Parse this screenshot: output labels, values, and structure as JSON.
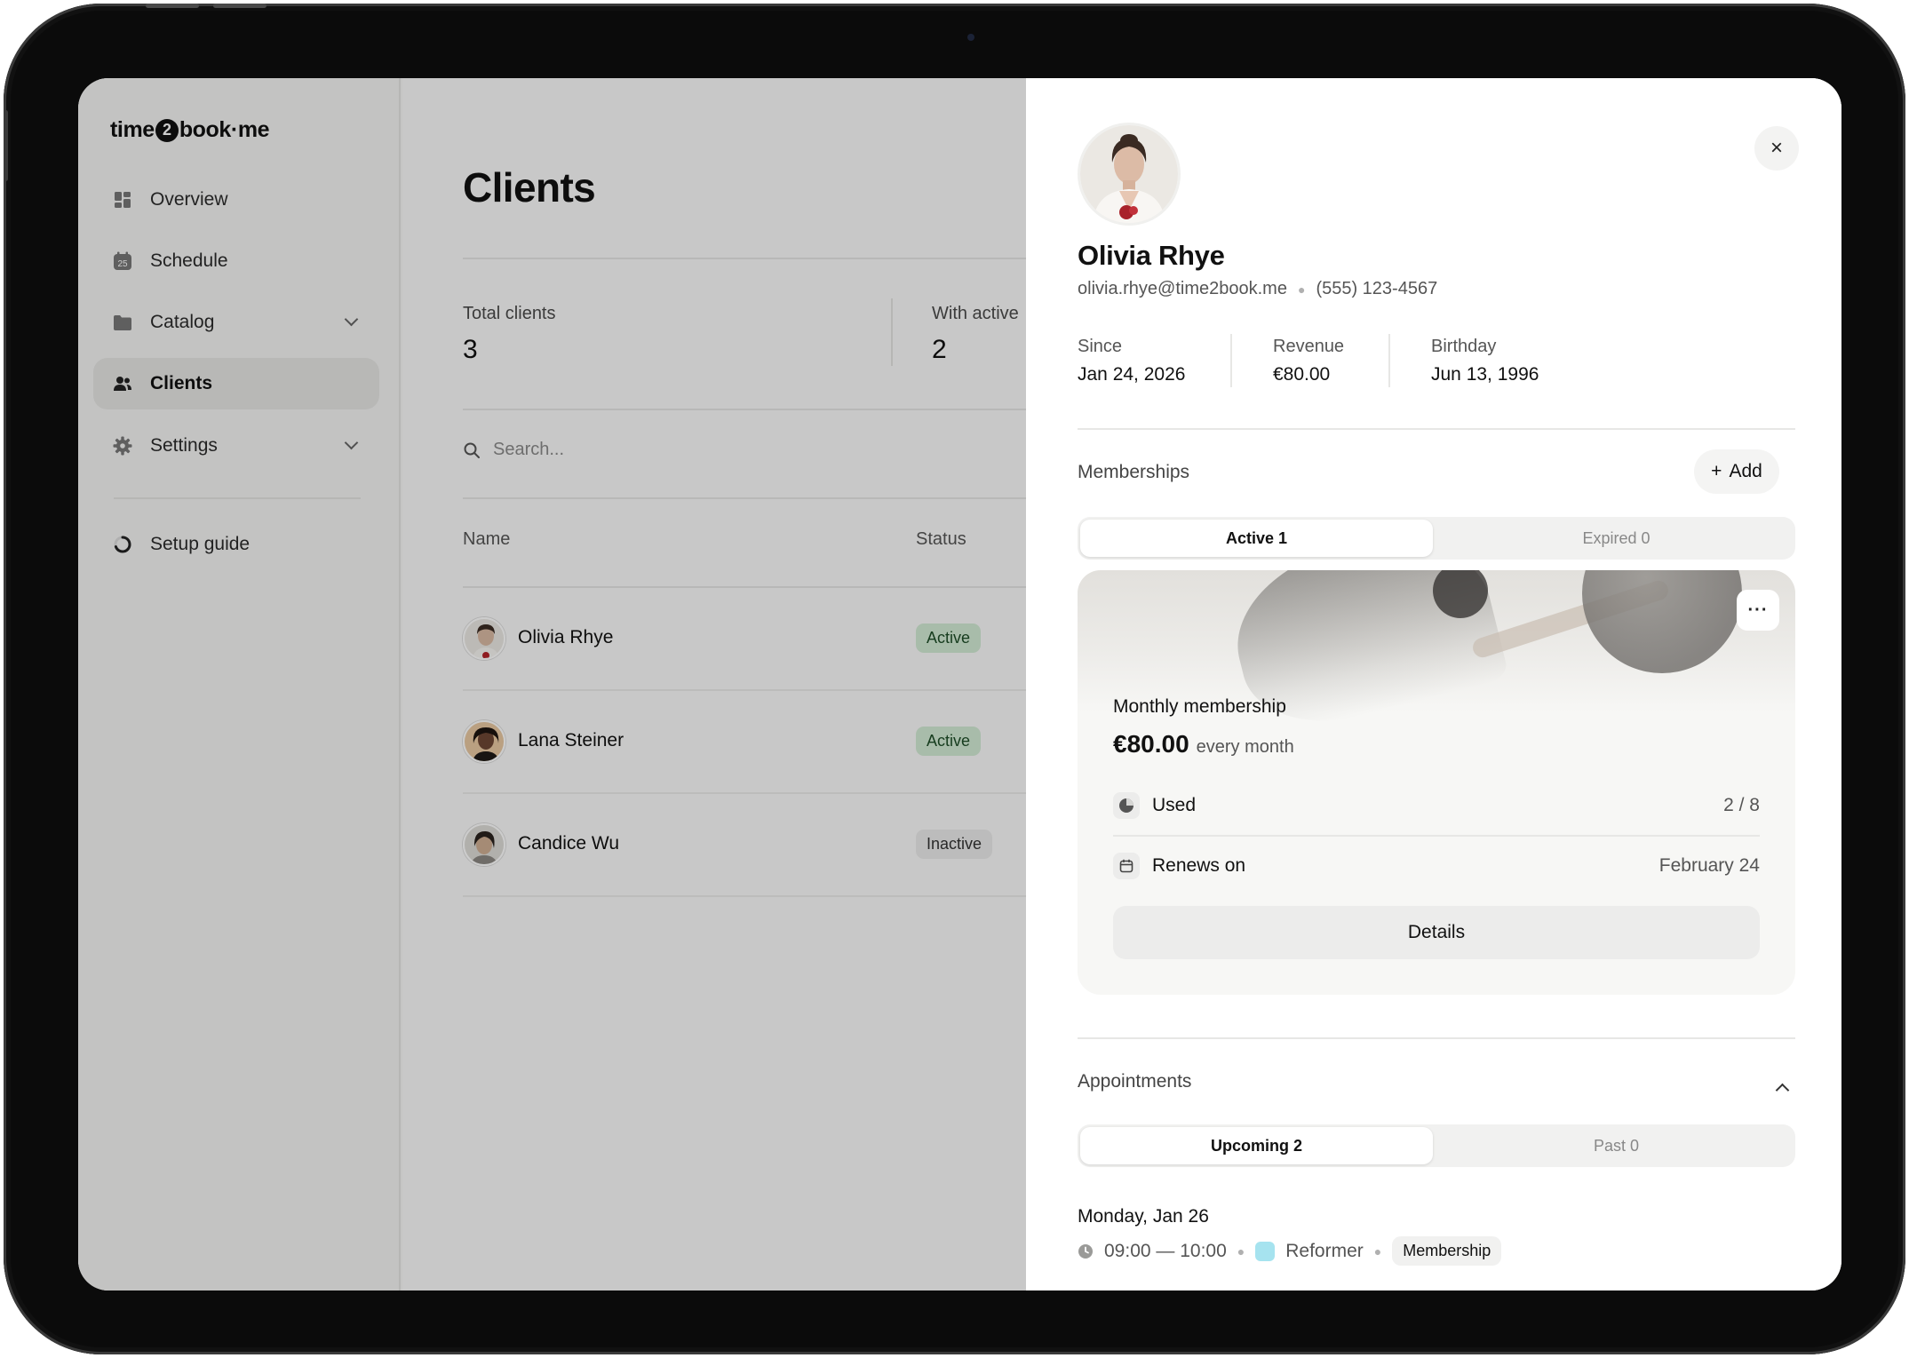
{
  "app": {
    "logo_left": "time",
    "logo_badge": "2",
    "logo_right": "book·me"
  },
  "sidebar": {
    "items": [
      {
        "label": "Overview",
        "icon": "grid-icon"
      },
      {
        "label": "Schedule",
        "icon": "calendar-icon"
      },
      {
        "label": "Catalog",
        "icon": "folder-icon"
      },
      {
        "label": "Clients",
        "icon": "users-icon"
      },
      {
        "label": "Settings",
        "icon": "gear-icon"
      }
    ],
    "active": "Clients",
    "setup": "Setup guide",
    "calendar_day": "25"
  },
  "main": {
    "title": "Clients",
    "stats": [
      {
        "label": "Total clients",
        "value": "3"
      },
      {
        "label": "With active",
        "value": "2"
      }
    ],
    "search_placeholder": "Search...",
    "columns": [
      "Name",
      "Status"
    ],
    "rows": [
      {
        "name": "Olivia Rhye",
        "status": "Active"
      },
      {
        "name": "Lana Steiner",
        "status": "Active"
      },
      {
        "name": "Candice Wu",
        "status": "Inactive"
      }
    ]
  },
  "panel": {
    "close": "×",
    "name": "Olivia Rhye",
    "email": "olivia.rhye@time2book.me",
    "phone": "(555) 123-4567",
    "meta": [
      {
        "label": "Since",
        "value": "Jan 24, 2026"
      },
      {
        "label": "Revenue",
        "value": "€80.00"
      },
      {
        "label": "Birthday",
        "value": "Jun 13, 1996"
      }
    ],
    "memberships": {
      "title": "Memberships",
      "add": "Add",
      "tabs": [
        "Active 1",
        "Expired 0"
      ],
      "card": {
        "more": "···",
        "title": "Monthly membership",
        "price": "€80.00",
        "period": "every month",
        "used_label": "Used",
        "used_value": "2 / 8",
        "used_fraction": 0.25,
        "renews_label": "Renews on",
        "renews_value": "February 24",
        "details": "Details"
      }
    },
    "appointments": {
      "title": "Appointments",
      "tabs": [
        "Upcoming 2",
        "Past 0"
      ],
      "date": "Monday, Jan 26",
      "time": "09:00 — 10:00",
      "service": "Reformer",
      "service_color": "#a6e3ef",
      "tag": "Membership"
    }
  },
  "colors": {
    "active_badge_bg": "#d3ebd5",
    "active_badge_text": "#1d4d27",
    "overlay": "rgba(0,0,0,0.20)"
  }
}
